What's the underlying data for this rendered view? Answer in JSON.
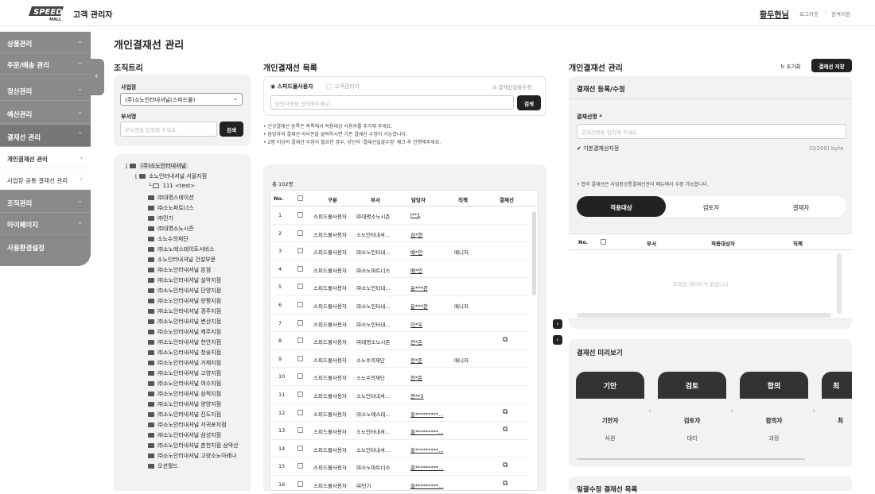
{
  "header": {
    "logo_text": "SPEED MALL",
    "title": "고객 관리자",
    "user": "황두현님",
    "logout": "로그아웃",
    "remote": "원격지원"
  },
  "sidebar": {
    "items": [
      {
        "label": "상품관리",
        "chevron": "⌄"
      },
      {
        "label": "주문/배송 관리",
        "chevron": "⌄"
      },
      {
        "label": "정산관리",
        "chevron": "⌄"
      },
      {
        "label": "예산관리",
        "chevron": "⌄"
      },
      {
        "label": "결재선 관리",
        "chevron": "⌃"
      },
      {
        "label": "조직관리",
        "chevron": "⌄"
      },
      {
        "label": "마이페이지",
        "chevron": "⌄"
      },
      {
        "label": "사용환경설정",
        "chevron": ""
      }
    ],
    "subitems": [
      {
        "label": "개인결재선 관리"
      },
      {
        "label": "사업장 공통 결재선 관리"
      }
    ],
    "collapse_icon": "‹"
  },
  "page_title": "개인결재선 관리",
  "org_tree": {
    "title": "조직트리",
    "site_label": "사업장",
    "site_value": "(주)소노인터내셔널(스피드몰)",
    "dept_label": "부서명",
    "dept_placeholder": "부서명을 입력해 주세요.",
    "search_button": "검색",
    "root": "(주)소노인터내셔널",
    "branch": "소노인터내셔널 서울지점",
    "leaf": "111 <test>",
    "nodes": [
      "㈜대명스테이션",
      "㈜소노파트너스",
      "㈜민기",
      "㈜대명소노시즌",
      "소노수의재단",
      "㈜소노에스테이트서비스",
      "소노인터내셔널 건설부문",
      "㈜소노인터내셔널 본점",
      "㈜소노인터내셔널 설악지점",
      "㈜소노인터내셔널 단양지점",
      "㈜소노인터내셔널 양평지점",
      "㈜소노인터내셔널 경주지점",
      "㈜소노인터내셔널 변산지점",
      "㈜소노인터내셔널 제주지점",
      "㈜소노인터내셔널 천안지점",
      "㈜소노인터내셔널 청송지점",
      "㈜소노인터내셔널 거제지점",
      "㈜소노인터내셔널 고양지점",
      "㈜소노인터내셔널 여수지점",
      "㈜소노인터내셔널 삼척지점",
      "㈜소노인터내셔널 양양지점",
      "㈜소노인터내셔널 진도지점",
      "㈜소노인터내셔널 서귀포지점",
      "㈜소노인터내셔널 삼성지점",
      "㈜소노인터내셔널 춘천지점 삼악산",
      "㈜소노인터내셔널 고양소노아레나",
      "오션월드"
    ]
  },
  "list": {
    "title": "개인결재선 목록",
    "radio1": "스피드몰사용자",
    "radio2": "고객관리자",
    "bulk_edit": "결재선일괄수정",
    "search_placeholder": "담당자명을 입력해주세요.",
    "search_button": "검색",
    "notes": [
      "• 신규결재선 등록은 목록에서 적용대상 사용자를 추가해 주세요.",
      "• 담당자의 결재선 아이콘을 클릭하시면 기존 결재선 수정이 가능합니다.",
      "• 2명 이상의 결재선 수정이 필요한 경우, 상단의 '결재선일괄수정' 체크 후 진행해주세요."
    ],
    "total": "총 102명",
    "columns": [
      "No.",
      "구분",
      "부서",
      "담당자",
      "직책",
      "결재선"
    ],
    "rows": [
      {
        "no": "1",
        "type": "스피드몰사용자",
        "dept": "㈜대명소노시즌",
        "person": "l**1",
        "title": "",
        "icon": false
      },
      {
        "no": "2",
        "type": "스피드몰사용자",
        "dept": "소노인터내셔...",
        "person": "김*현",
        "title": "",
        "icon": false
      },
      {
        "no": "3",
        "type": "스피드몰사용자",
        "dept": "㈜소노인터내...",
        "person": "배*민",
        "title": "매니저",
        "icon": false
      },
      {
        "no": "4",
        "type": "스피드몰사용자",
        "dept": "㈜소노파트너스",
        "person": "배*민",
        "title": "",
        "icon": false
      },
      {
        "no": "5",
        "type": "스피드몰사용자",
        "dept": "㈜소노인터내...",
        "person": "윤***관",
        "title": "",
        "icon": false
      },
      {
        "no": "6",
        "type": "스피드몰사용자",
        "dept": "㈜소노인터내...",
        "person": "윤***관",
        "title": "매니저",
        "icon": false
      },
      {
        "no": "7",
        "type": "스피드몰사용자",
        "dept": "㈜소노인터내...",
        "person": "이*우",
        "title": "",
        "icon": false
      },
      {
        "no": "8",
        "type": "스피드몰사용자",
        "dept": "㈜대명소노시즌",
        "person": "전*돈",
        "title": "",
        "icon": true
      },
      {
        "no": "9",
        "type": "스피드몰사용자",
        "dept": "소노수의재단",
        "person": "전*돈",
        "title": "매니저",
        "icon": false
      },
      {
        "no": "10",
        "type": "스피드몰사용자",
        "dept": "소노수의재단",
        "person": "전*돈",
        "title": "",
        "icon": false
      },
      {
        "no": "11",
        "type": "스피드몰사용자",
        "dept": "소노인터내셔...",
        "person": "전**3",
        "title": "",
        "icon": false
      },
      {
        "no": "12",
        "type": "스피드몰사용자",
        "dept": "㈜소노에스테...",
        "person": "홍*********...",
        "title": "",
        "icon": true
      },
      {
        "no": "13",
        "type": "스피드몰사용자",
        "dept": "소노인터내셔...",
        "person": "홍*********...",
        "title": "",
        "icon": true
      },
      {
        "no": "14",
        "type": "스피드몰사용자",
        "dept": "소노인터내셔...",
        "person": "홍*********...",
        "title": "",
        "icon": false
      },
      {
        "no": "15",
        "type": "스피드몰사용자",
        "dept": "㈜소노파트너스",
        "person": "홍*********...",
        "title": "",
        "icon": true
      },
      {
        "no": "16",
        "type": "스피드몰사용자",
        "dept": "㈜민기",
        "person": "홍*********...",
        "title": "",
        "icon": true
      }
    ]
  },
  "manage": {
    "title": "개인결재선 관리",
    "reset": "초기화",
    "save": "결재선 저장",
    "reg_title": "결재선 등록/수정",
    "name_label": "결재선명 *",
    "name_placeholder": "결재선명을 입력해 주세요.",
    "default_label": "기본결재선지정",
    "byte_count": "(0/200) byte",
    "notice": "• 합의 결재선은 사업장공통결재선관리 메뉴에서 수정 가능합니다.",
    "tabs": [
      "적용대상",
      "검토자",
      "결재자"
    ],
    "columns": [
      "No.",
      "부서",
      "적용대상자",
      "직책"
    ],
    "empty": "조회된 데이터가 없습니다.",
    "preview_title": "결재선 미리보기",
    "stages": [
      {
        "head": "기안",
        "role": "기안자",
        "rank": "사원"
      },
      {
        "head": "검토",
        "role": "검토자",
        "rank": "대리"
      },
      {
        "head": "합의",
        "role": "합의자",
        "rank": "과장"
      },
      {
        "head": "최",
        "role": "최",
        "rank": ""
      }
    ],
    "bulk_list_title": "일괄수정 결재선 목록"
  },
  "mid_buttons": {
    "right": "›",
    "left": "‹"
  }
}
